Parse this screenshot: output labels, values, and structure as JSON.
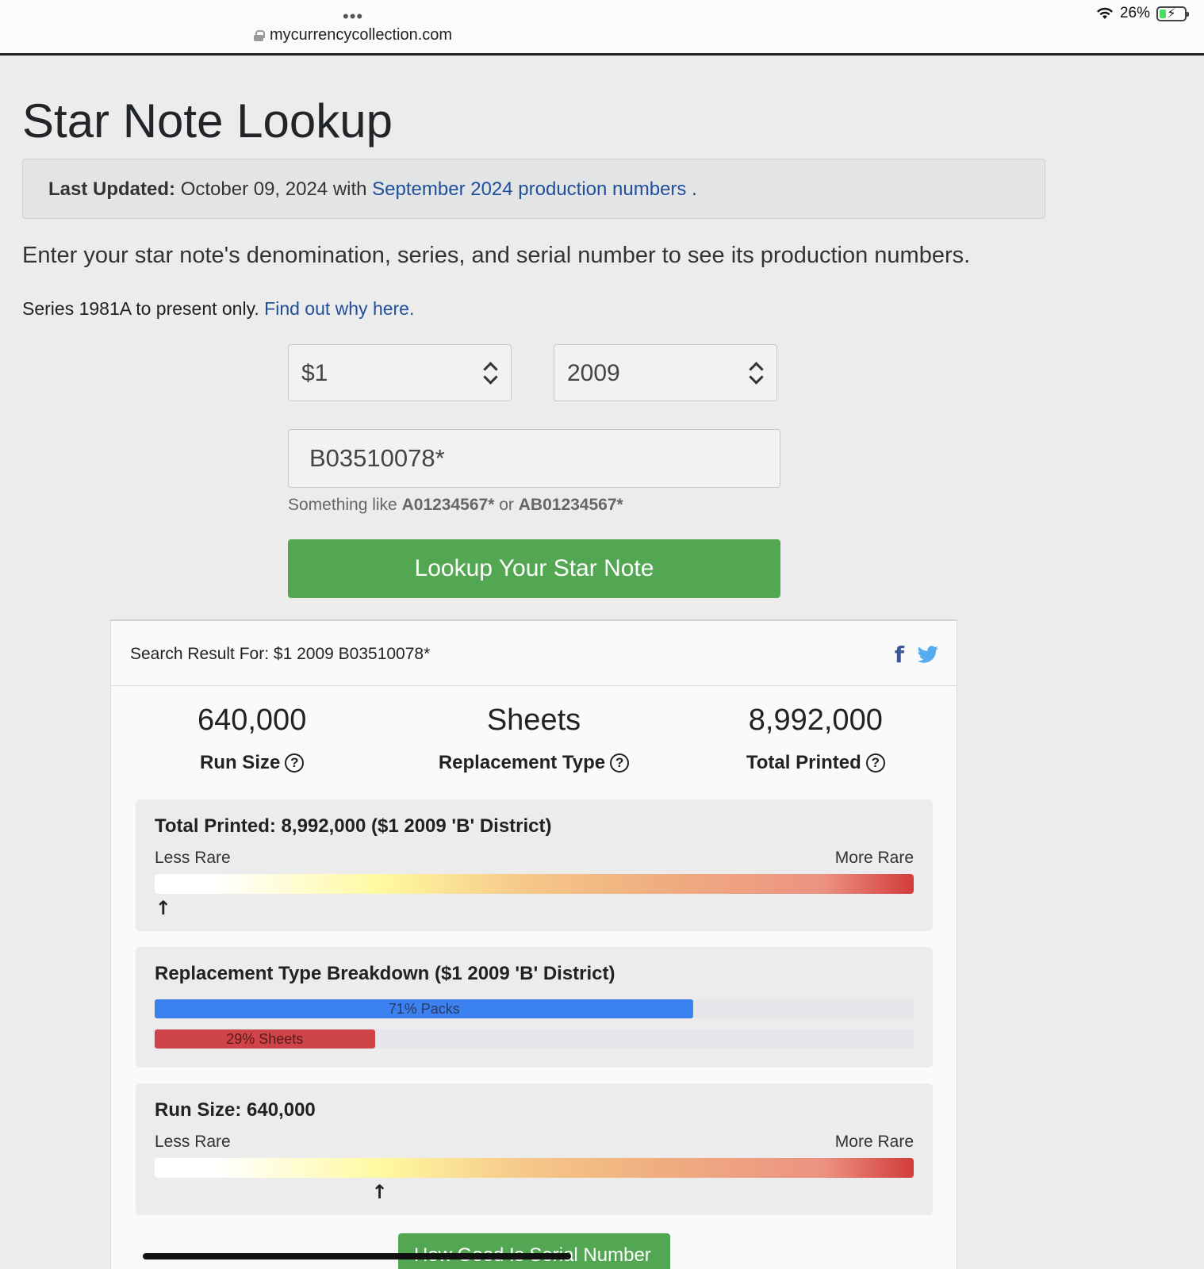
{
  "browser": {
    "url": "mycurrencycollection.com",
    "battery": "26%",
    "battery_level": 0.26
  },
  "page": {
    "title": "Star Note Lookup",
    "update": {
      "label": "Last Updated:",
      "date": "October 09, 2024 with",
      "link": "September 2024 production numbers",
      "trail": "."
    },
    "intro": "Enter your star note's denomination, series, and serial number to see its production numbers.",
    "series_note": "Series 1981A to present only.",
    "series_link": "Find out why here."
  },
  "form": {
    "denomination": "$1",
    "series": "2009",
    "serial": "B03510078*",
    "hint_prefix": "Something like",
    "hint_example1": "A01234567*",
    "hint_or": "or",
    "hint_example2": "AB01234567*",
    "submit": "Lookup Your Star Note"
  },
  "result": {
    "header": "Search Result For: $1 2009 B03510078*",
    "stats": [
      {
        "value": "640,000",
        "label": "Run Size"
      },
      {
        "value": "Sheets",
        "label": "Replacement Type"
      },
      {
        "value": "8,992,000",
        "label": "Total Printed"
      }
    ],
    "total_panel": {
      "title": "Total Printed: 8,992,000 ($1 2009 'B' District)",
      "less": "Less Rare",
      "more": "More Rare",
      "marker_fraction": 0.005
    },
    "replacement_panel": {
      "title": "Replacement Type Breakdown ($1 2009 'B' District)",
      "bars": [
        {
          "label": "71% Packs",
          "percent": 71,
          "color": "#3b82f0"
        },
        {
          "label": "29% Sheets",
          "percent": 29,
          "color": "#cf4448"
        }
      ]
    },
    "run_panel": {
      "title": "Run Size: 640,000",
      "less": "Less Rare",
      "more": "More Rare",
      "marker_fraction": 0.29
    },
    "bottom_button": "How Good Is Serial Number"
  }
}
